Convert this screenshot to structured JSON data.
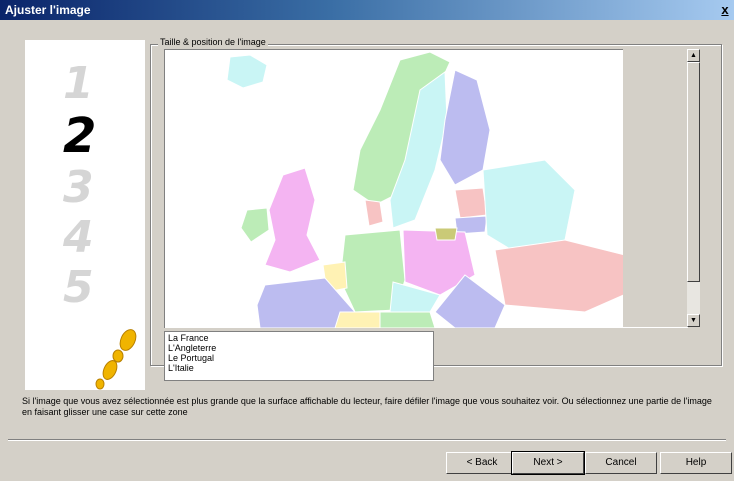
{
  "window": {
    "title": "Ajuster l'image",
    "close_label": "x"
  },
  "steps": [
    "1",
    "2",
    "3",
    "4",
    "5"
  ],
  "active_step": "2",
  "group": {
    "label": "Taille & position de l'image"
  },
  "list": {
    "items": [
      "La France",
      "L'Angleterre",
      "Le Portugal",
      "L'Italie"
    ]
  },
  "help_text": "Si l'image que vous avez sélectionnée est plus grande que la surface affichable du lecteur, faire défiler l'image que vous souhaitez voir. Ou sélectionnez une partie de l'image en faisant glisser une case sur cette zone",
  "buttons": {
    "back": "< Back",
    "next": "Next >",
    "cancel": "Cancel",
    "help": "Help"
  },
  "colors": {
    "title_start": "#0a246a",
    "title_end": "#a6caf0",
    "dialog_bg": "#d4d0c8"
  }
}
